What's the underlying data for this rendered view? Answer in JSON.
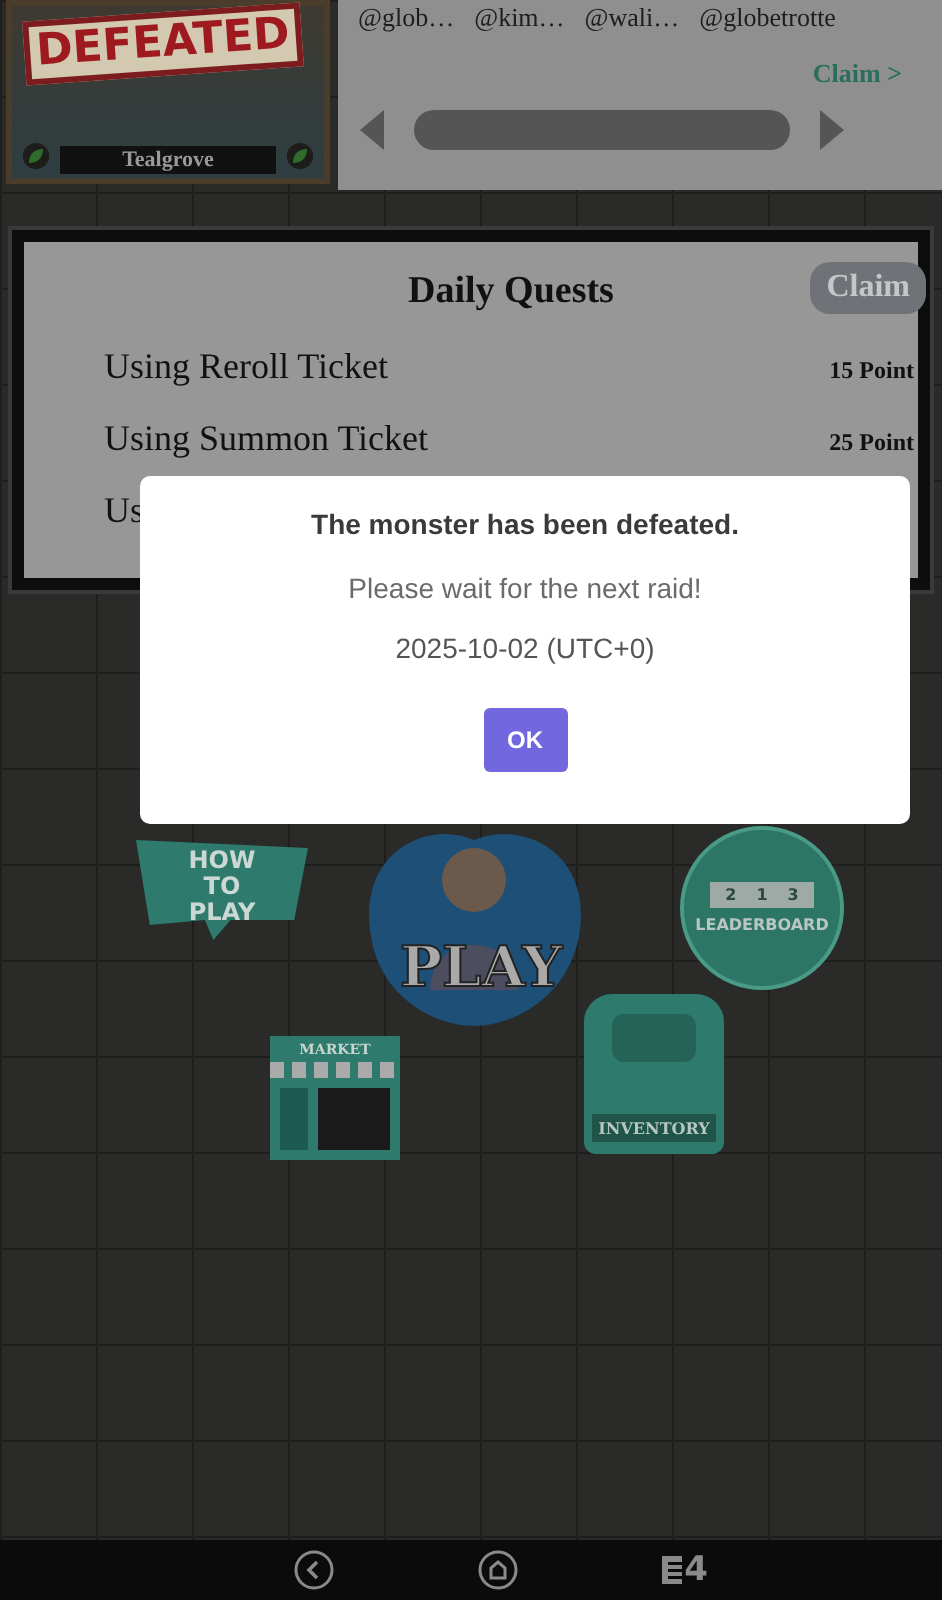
{
  "hero_card": {
    "stamp": "DEFEATED",
    "name": "Tealgrove"
  },
  "ranking": {
    "users": [
      "@glob…",
      "@kim…",
      "@wali…",
      "@globetrotte"
    ],
    "link": "Claim >"
  },
  "daily_quests": {
    "title": "Daily Quests",
    "claim_button": {
      "label": "Claim",
      "disabled": true
    },
    "quests": [
      {
        "name": "Using Reroll Ticket",
        "points": "15 Point"
      },
      {
        "name": "Using Summon Ticket",
        "points": "25 Point"
      },
      {
        "name": "Us"
      }
    ]
  },
  "menu": [
    {
      "kind": "how_to_play",
      "label": "HOW TO PLAY"
    },
    {
      "kind": "play",
      "label": "PLAY"
    },
    {
      "kind": "leaderboard",
      "label": "LEADERBOARD",
      "ranks": [
        "2",
        "1",
        "3"
      ]
    },
    {
      "kind": "market",
      "label": "MARKET"
    },
    {
      "kind": "inventory",
      "label": "INVENTORY"
    }
  ],
  "dialog": {
    "title": "The monster has been defeated.",
    "message": "Please wait for the next raid!",
    "date": "2025-10-02 (UTC+0)",
    "button": "OK"
  },
  "nav_bar": {
    "tabs_count": "4"
  }
}
